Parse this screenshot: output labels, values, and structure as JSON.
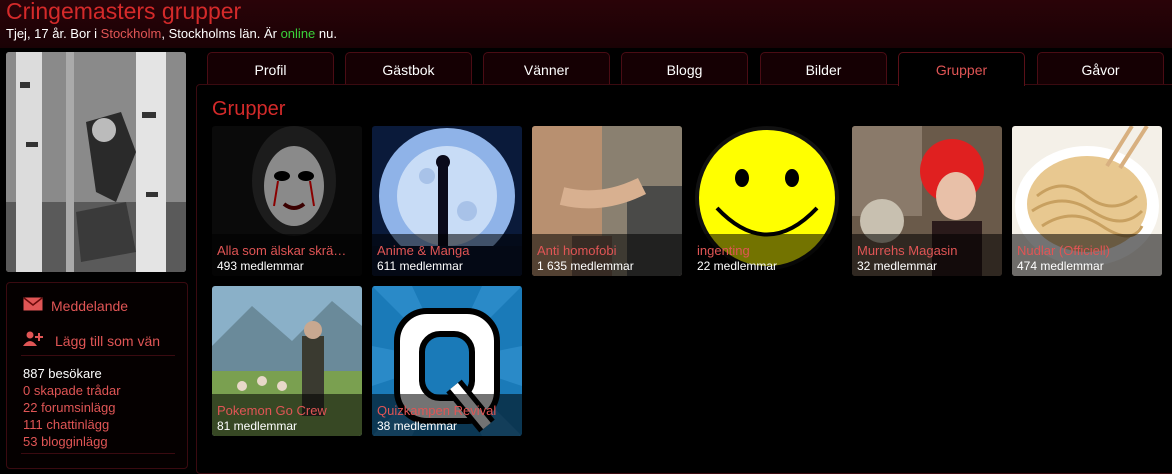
{
  "header": {
    "title": "Cringemasters grupper",
    "bio_prefix": "Tjej, 17 år. Bor i ",
    "city": "Stockholm",
    "bio_middle": ", Stockholms län. Är ",
    "status": "online",
    "bio_suffix": " nu."
  },
  "tabs": [
    {
      "label": "Profil"
    },
    {
      "label": "Gästbok"
    },
    {
      "label": "Vänner"
    },
    {
      "label": "Blogg"
    },
    {
      "label": "Bilder"
    },
    {
      "label": "Grupper",
      "active": true
    },
    {
      "label": "Gåvor"
    }
  ],
  "sidebar": {
    "message_label": "Meddelande",
    "add_friend_label": "Lägg till som vän",
    "visitors": "887 besökare",
    "threads": "0 skapade trådar",
    "forum_posts": "22 forumsinlägg",
    "chat_posts": "111 chattinlägg",
    "blog_posts": "53 blogginlägg"
  },
  "main": {
    "section_title": "Grupper",
    "groups": [
      {
        "name": "Alla som älskar skrä…",
        "members": "493 medlemmar"
      },
      {
        "name": "Anime & Manga",
        "members": "611 medlemmar"
      },
      {
        "name": "Anti homofobi",
        "members": "1 635 medlemmar"
      },
      {
        "name": "ingenting",
        "members": "22 medlemmar"
      },
      {
        "name": "Murrehs Magasin",
        "members": "32 medlemmar"
      },
      {
        "name": "Nudlar (Officiell)",
        "members": "474 medlemmar"
      },
      {
        "name": "Pokemon Go Crew",
        "members": "81 medlemmar"
      },
      {
        "name": "Quizkampen Revival",
        "members": "38 medlemmar"
      }
    ]
  },
  "colors": {
    "accent_red": "#d42a2a",
    "link_red": "#e05555",
    "online_green": "#3ad13a",
    "background": "#000000"
  },
  "icons": {
    "message": "envelope-icon",
    "add_friend": "add-user-icon"
  }
}
